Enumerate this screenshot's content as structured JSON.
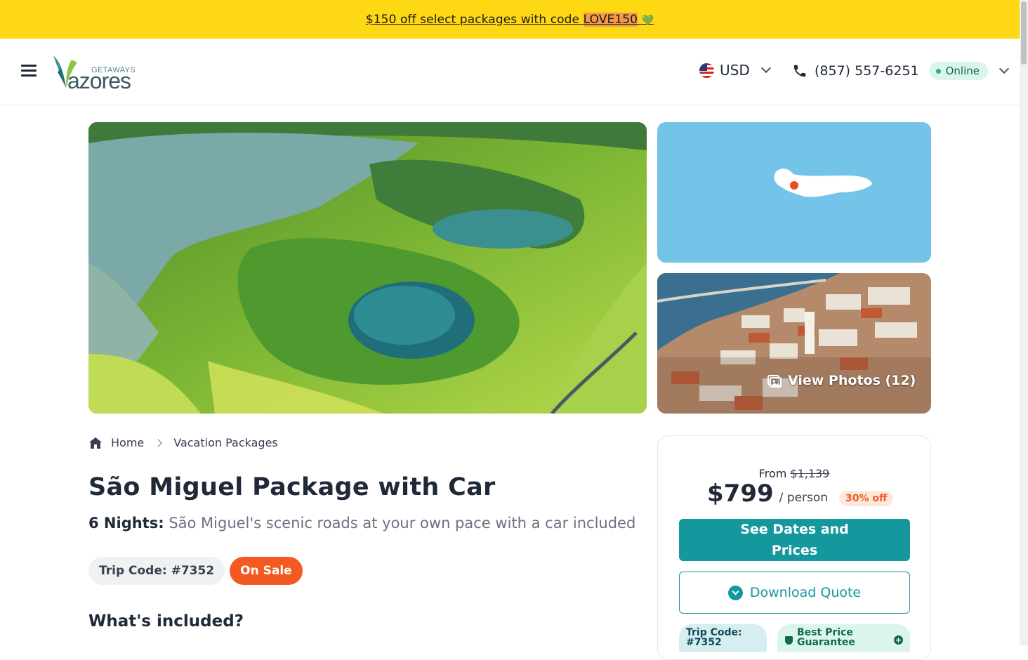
{
  "promo": {
    "text_before": "$150 off select packages with code ",
    "code": "LOVE150",
    "heart": "💚"
  },
  "header": {
    "logo_small": "GETAWAYS",
    "logo_big": "azores",
    "currency": "USD",
    "phone": "(857) 557-6251",
    "status": "Online"
  },
  "gallery": {
    "view_photos": "View Photos (12)"
  },
  "breadcrumb": {
    "home": "Home",
    "current": "Vacation Packages"
  },
  "package": {
    "title": "São Miguel Package with Car",
    "nights": "6 Nights:",
    "tagline": "São Miguel's scenic roads at your own pace with a car included",
    "trip_code": "Trip Code: #7352",
    "sale_badge": "On Sale",
    "included_heading": "What's included?"
  },
  "pricing": {
    "from_label": "From",
    "original_price": "$1,139",
    "price": "$799",
    "per": "/ person",
    "discount": "30% off",
    "see_dates_line1": "See Dates and",
    "see_dates_line2": "Prices",
    "download": "Download Quote",
    "mini_trip_line1": "Trip Code:",
    "mini_trip_line2": "#7352",
    "best_line1": "Best Price",
    "best_line2": "Guarantee"
  },
  "colors": {
    "promo_bg": "#ffd814",
    "accent_teal": "#15979e",
    "sale_orange": "#f25a22",
    "online_green": "#28b07a"
  }
}
